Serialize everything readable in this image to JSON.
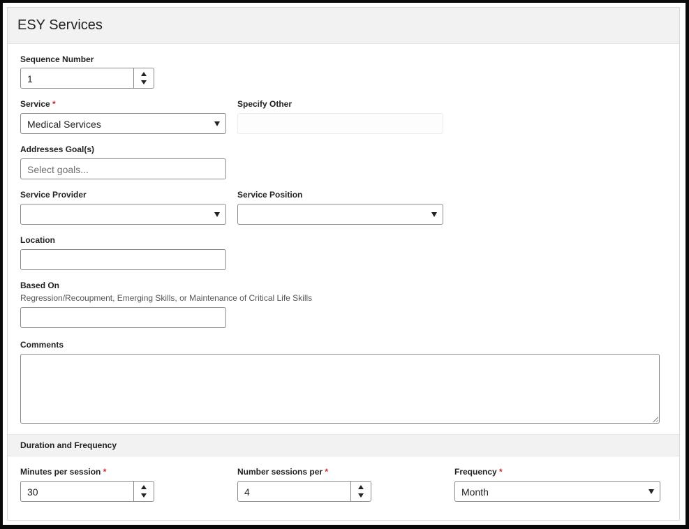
{
  "header": {
    "title": "ESY Services"
  },
  "sequence": {
    "label": "Sequence Number",
    "value": "1"
  },
  "service": {
    "label": "Service",
    "required_mark": "*",
    "value": "Medical Services"
  },
  "specify_other": {
    "label": "Specify Other",
    "value": ""
  },
  "goals": {
    "label": "Addresses Goal(s)",
    "placeholder": "Select goals..."
  },
  "provider": {
    "label": "Service Provider",
    "value": ""
  },
  "position": {
    "label": "Service Position",
    "value": ""
  },
  "location": {
    "label": "Location",
    "value": ""
  },
  "based_on": {
    "label": "Based On",
    "hint": "Regression/Recoupment, Emerging Skills, or Maintenance of Critical Life Skills",
    "value": ""
  },
  "comments": {
    "label": "Comments",
    "value": ""
  },
  "duration": {
    "section_title": "Duration and Frequency",
    "minutes": {
      "label": "Minutes per session",
      "required_mark": "*",
      "value": "30"
    },
    "sessions": {
      "label": "Number sessions per",
      "required_mark": "*",
      "value": "4"
    },
    "frequency": {
      "label": "Frequency",
      "required_mark": "*",
      "value": "Month"
    }
  },
  "colors": {
    "required": "#c62828",
    "header_bg": "#f2f2f2",
    "border": "#8a8a8a"
  },
  "icons": {
    "spinner": [
      "chevron-up-icon",
      "chevron-down-icon"
    ],
    "dropdown": "caret-down-icon",
    "resize": "resize-grip-icon"
  }
}
